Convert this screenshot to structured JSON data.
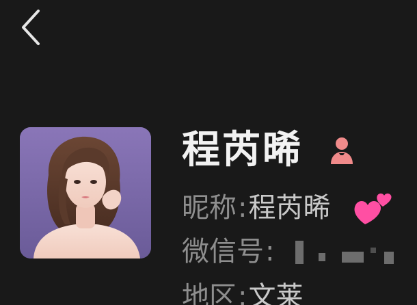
{
  "header": {
    "back_icon": "chevron-left-icon"
  },
  "profile": {
    "avatar_icon": "profile-photo",
    "display_name": "程芮晞",
    "gender_icon": "female-user-icon",
    "gender_color": "#f08a8a",
    "nickname": {
      "label": "昵称",
      "separator": ":",
      "value": "程芮晞",
      "emoji": "💕"
    },
    "wechat_id": {
      "label": "微信号",
      "separator": ":",
      "value_redacted": true
    },
    "region": {
      "label": "地区",
      "separator": ":",
      "value": "文莱"
    }
  },
  "colors": {
    "background": "#191919",
    "primary_text": "#f2f2f2",
    "secondary_text": "#8e8e8e",
    "heart_pink": "#ff4fa3"
  }
}
